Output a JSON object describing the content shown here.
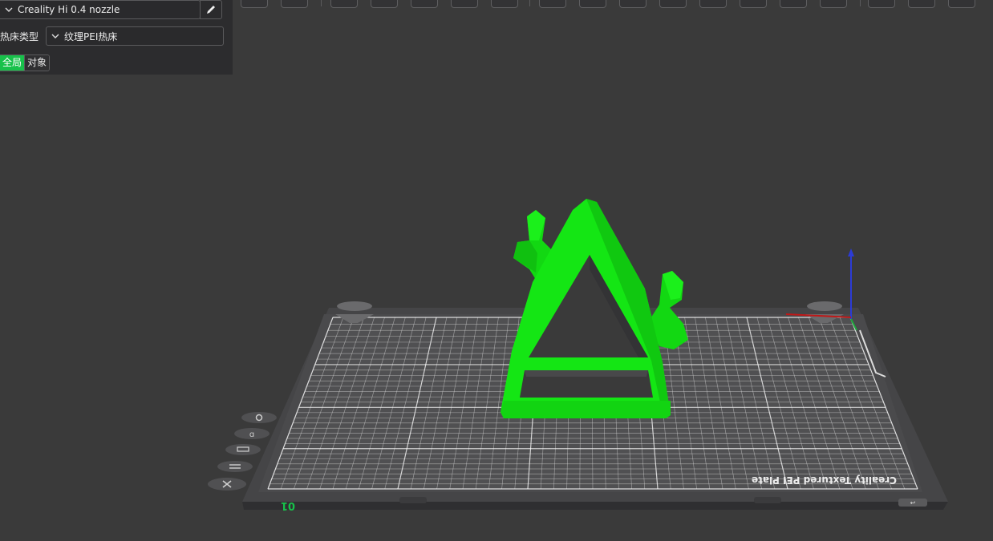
{
  "panel": {
    "printer": "Creality Hi 0.4 nozzle",
    "bed_type_label": "热床类型",
    "bed_type_value": "纹理PEI热床",
    "tabs": [
      "全局",
      "对象"
    ]
  },
  "toolbar": {
    "icons": [
      "cube-icon",
      "keyboard-icon",
      "ruler-icon",
      "support-icon",
      "paint-icon",
      "split-icon",
      "layers-icon",
      "arrange-icon",
      "orient-icon",
      "measure-icon",
      "scale-icon",
      "cut-icon",
      "seam-icon",
      "text-icon",
      "assembly-icon",
      "variable-layer-icon",
      "emboss-icon",
      "brim-icon"
    ]
  },
  "viewport": {
    "plate_label": "Creality Textured PEI Plate",
    "plate_number": "01",
    "view_controls": [
      "gear-icon",
      "lock-icon",
      "arrange-icon",
      "layers-icon",
      "close-icon"
    ]
  },
  "colors": {
    "accent": "#17c14a",
    "model": "#14e614",
    "background": "#3a3a3a"
  }
}
